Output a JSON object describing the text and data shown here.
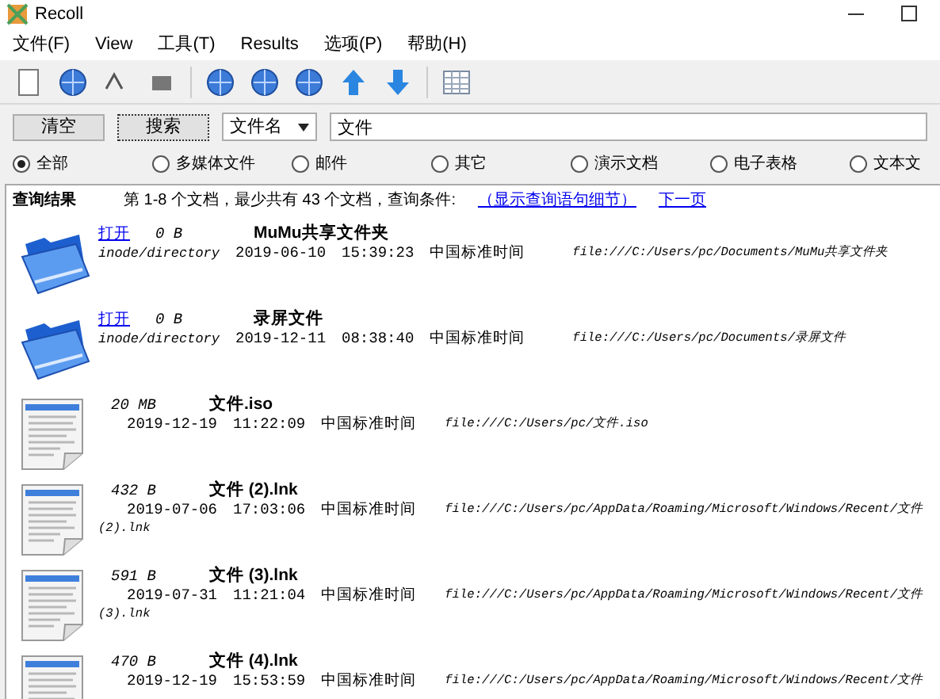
{
  "window": {
    "title": "Recoll"
  },
  "menu": [
    "文件(F)",
    "View",
    "工具(T)",
    "Results",
    "选项(P)",
    "帮助(H)"
  ],
  "search": {
    "clear_button": "清空",
    "search_button": "搜索",
    "mode": "文件名",
    "value": "文件"
  },
  "filters": [
    {
      "label": "全部",
      "selected": true
    },
    {
      "label": "多媒体文件",
      "selected": false
    },
    {
      "label": "邮件",
      "selected": false
    },
    {
      "label": "其它",
      "selected": false
    },
    {
      "label": "演示文档",
      "selected": false
    },
    {
      "label": "电子表格",
      "selected": false
    },
    {
      "label": "文本文",
      "selected": false
    }
  ],
  "results": {
    "heading": "查询结果",
    "summary": "第 1-8 个文档，最少共有 43 个文档，查询条件:",
    "details_link": "（显示查询语句细节）",
    "next_link": "下一页",
    "items": [
      {
        "kind": "folder",
        "open_link": "打开",
        "size": "0 B",
        "title": "MuMu共享文件夹",
        "mime": "inode/directory",
        "date": "2019-06-10",
        "time": "15:39:23",
        "zone": "中国标准时间",
        "url_lines": [
          "file:///C:/Users/pc/Documents/MuMu共享文件夹"
        ]
      },
      {
        "kind": "folder",
        "open_link": "打开",
        "size": "0 B",
        "title": "录屏文件",
        "mime": "inode/directory",
        "date": "2019-12-11",
        "time": "08:38:40",
        "zone": "中国标准时间",
        "url_lines": [
          "file:///C:/Users/pc/Documents/录屏文件"
        ]
      },
      {
        "kind": "file",
        "size": "20 MB",
        "title": "文件.iso",
        "date": "2019-12-19",
        "time": "11:22:09",
        "zone": "中国标准时间",
        "url_lines": [
          "file:///C:/Users/pc/文件.iso"
        ]
      },
      {
        "kind": "file",
        "size": "432 B",
        "title": "文件 (2).lnk",
        "date": "2019-07-06",
        "time": "17:03:06",
        "zone": "中国标准时间",
        "url_lines": [
          "file:///C:/Users/pc/AppData/Roaming/Microsoft/Windows/Recent/文件",
          "(2).lnk"
        ]
      },
      {
        "kind": "file",
        "size": "591 B",
        "title": "文件 (3).lnk",
        "date": "2019-07-31",
        "time": "11:21:04",
        "zone": "中国标准时间",
        "url_lines": [
          "file:///C:/Users/pc/AppData/Roaming/Microsoft/Windows/Recent/文件",
          "(3).lnk"
        ]
      },
      {
        "kind": "file",
        "size": "470 B",
        "title": "文件 (4).lnk",
        "date": "2019-12-19",
        "time": "15:53:59",
        "zone": "中国标准时间",
        "url_lines": [
          "file:///C:/Users/pc/AppData/Roaming/Microsoft/Windows/Recent/文件"
        ]
      }
    ]
  }
}
